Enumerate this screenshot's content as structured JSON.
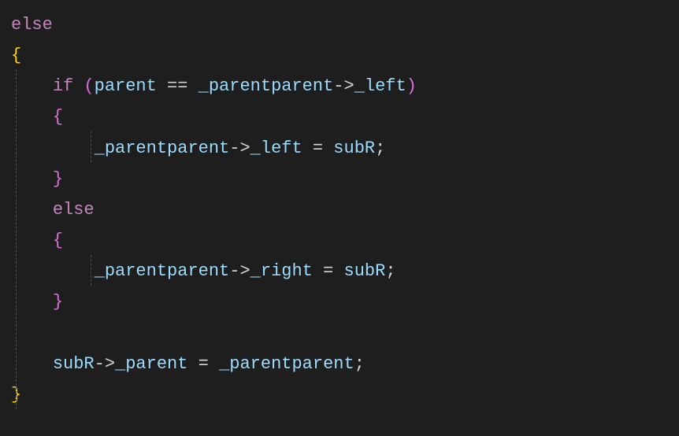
{
  "code": {
    "kw_else_1": "else",
    "brace_open_1": "{",
    "kw_if": "if",
    "paren_open": "(",
    "id_parent": "parent",
    "op_eq": "==",
    "id_parentparent_1": "_parentparent",
    "arrow_1": "->",
    "id_left_1": "_left",
    "paren_close": ")",
    "brace_open_2": "{",
    "id_parentparent_2": "_parentparent",
    "arrow_2": "->",
    "id_left_2": "_left",
    "op_assign_1": "=",
    "id_subR_1": "subR",
    "semi_1": ";",
    "brace_close_2": "}",
    "kw_else_2": "else",
    "brace_open_3": "{",
    "id_parentparent_3": "_parentparent",
    "arrow_3": "->",
    "id_right": "_right",
    "op_assign_2": "=",
    "id_subR_2": "subR",
    "semi_2": ";",
    "brace_close_3": "}",
    "id_subR_3": "subR",
    "arrow_4": "->",
    "id_parent_mem": "_parent",
    "op_assign_3": "=",
    "id_parentparent_4": "_parentparent",
    "semi_3": ";",
    "brace_close_1": "}"
  }
}
